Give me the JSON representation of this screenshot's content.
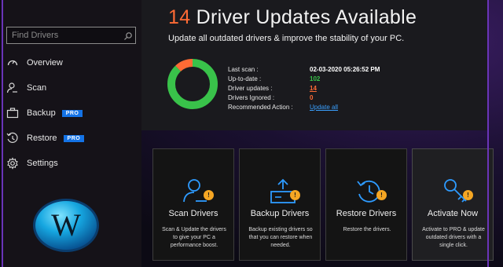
{
  "colors": {
    "accent_orange": "#ff6b35",
    "accent_green": "#39c24a",
    "link_blue": "#3aa0ff",
    "pro_blue": "#1473e6",
    "window_border": "#6a34b8",
    "badge_yellow": "#f5a623"
  },
  "search": {
    "placeholder": "Find Drivers",
    "icon": "search-icon"
  },
  "sidebar": {
    "items": [
      {
        "label": "Overview",
        "icon": "speedometer-icon",
        "pro": ""
      },
      {
        "label": "Scan",
        "icon": "scan-person-icon",
        "pro": ""
      },
      {
        "label": "Backup",
        "icon": "briefcase-icon",
        "pro": "PRO"
      },
      {
        "label": "Restore",
        "icon": "restore-clock-icon",
        "pro": "PRO"
      },
      {
        "label": "Settings",
        "icon": "gear-icon",
        "pro": ""
      }
    ]
  },
  "logo": {
    "letter": "W",
    "icon": "w-logo-icon"
  },
  "header": {
    "count": "14",
    "title_rest": "Driver Updates Available",
    "subtitle": "Update all outdated drivers & improve the stability of your PC."
  },
  "status_donut": {
    "up_to_date": 102,
    "driver_updates": 14,
    "drivers_ignored": 0
  },
  "stats": {
    "last_scan_label": "Last scan :",
    "last_scan_value": "02-03-2020 05:26:52 PM",
    "up_to_date_label": "Up-to-date :",
    "up_to_date_value": "102",
    "driver_updates_label": "Driver updates :",
    "driver_updates_value": "14",
    "drivers_ignored_label": "Drivers Ignored :",
    "drivers_ignored_value": "0",
    "recommended_label": "Recommended Action :",
    "recommended_value": "Update all"
  },
  "cards": [
    {
      "title": "Scan Drivers",
      "desc": "Scan & Update the drivers to give your PC a performance boost.",
      "icon": "scan-drivers-icon"
    },
    {
      "title": "Backup Drivers",
      "desc": "Backup existing drivers so that you can restore when needed.",
      "icon": "backup-drivers-icon"
    },
    {
      "title": "Restore Drivers",
      "desc": "Restore the drivers.",
      "icon": "restore-drivers-icon"
    },
    {
      "title": "Activate Now",
      "desc": "Activate to PRO & update outdated drivers with a single click.",
      "icon": "key-icon"
    }
  ],
  "badge_glyph": "!"
}
